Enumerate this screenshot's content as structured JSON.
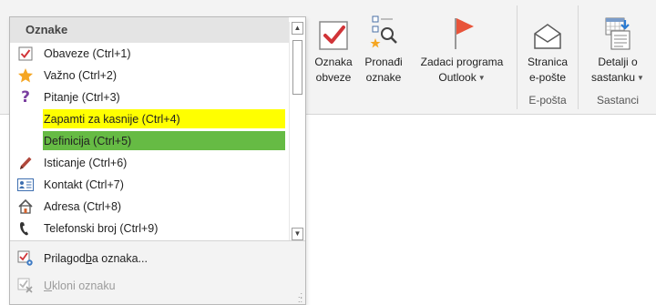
{
  "ribbon": {
    "buttons": [
      {
        "name": "oznaka-obveze",
        "line1": "Oznaka",
        "line2": "obveze",
        "dropdown": false
      },
      {
        "name": "pronadi-oznake",
        "line1": "Pronađi",
        "line2": "oznake",
        "dropdown": false
      },
      {
        "name": "zadaci-programa-outlook",
        "line1": "Zadaci programa",
        "line2": "Outlook",
        "dropdown": true
      },
      {
        "name": "stranica-e-poste",
        "line1": "Stranica",
        "line2": "e-pošte",
        "dropdown": false
      },
      {
        "name": "detalji-o-sastanku",
        "line1": "Detalji o",
        "line2": "sastanku",
        "dropdown": true
      }
    ],
    "groups": {
      "email": "E-pošta",
      "meetings": "Sastanci"
    }
  },
  "dropdown": {
    "header": "Oznake",
    "tags": [
      {
        "label": "Obaveze (Ctrl+1)",
        "icon": "checkbox-icon",
        "highlight": ""
      },
      {
        "label": "Važno (Ctrl+2)",
        "icon": "star-icon",
        "highlight": ""
      },
      {
        "label": "Pitanje (Ctrl+3)",
        "icon": "question-icon",
        "highlight": ""
      },
      {
        "label": "Zapamti za kasnije (Ctrl+4)",
        "icon": "",
        "highlight": "#ffff00"
      },
      {
        "label": "Definicija (Ctrl+5)",
        "icon": "",
        "highlight": "#66bb44"
      },
      {
        "label": "Isticanje (Ctrl+6)",
        "icon": "pen-icon",
        "highlight": ""
      },
      {
        "label": "Kontakt (Ctrl+7)",
        "icon": "contact-card-icon",
        "highlight": ""
      },
      {
        "label": "Adresa (Ctrl+8)",
        "icon": "house-icon",
        "highlight": ""
      },
      {
        "label": "Telefonski broj (Ctrl+9)",
        "icon": "phone-icon",
        "highlight": ""
      }
    ],
    "footer": {
      "customize_pre": "Prilagod",
      "customize_acc": "b",
      "customize_post": "a oznaka...",
      "remove_acc": "U",
      "remove_post": "kloni oznaku"
    }
  },
  "colors": {
    "checkbox_red": "#d13438",
    "star_orange": "#f5a623",
    "question_purple": "#7b3fa0",
    "flag_red": "#e8543a",
    "highlight_yellow": "#ffff00",
    "highlight_green": "#66bb44"
  }
}
